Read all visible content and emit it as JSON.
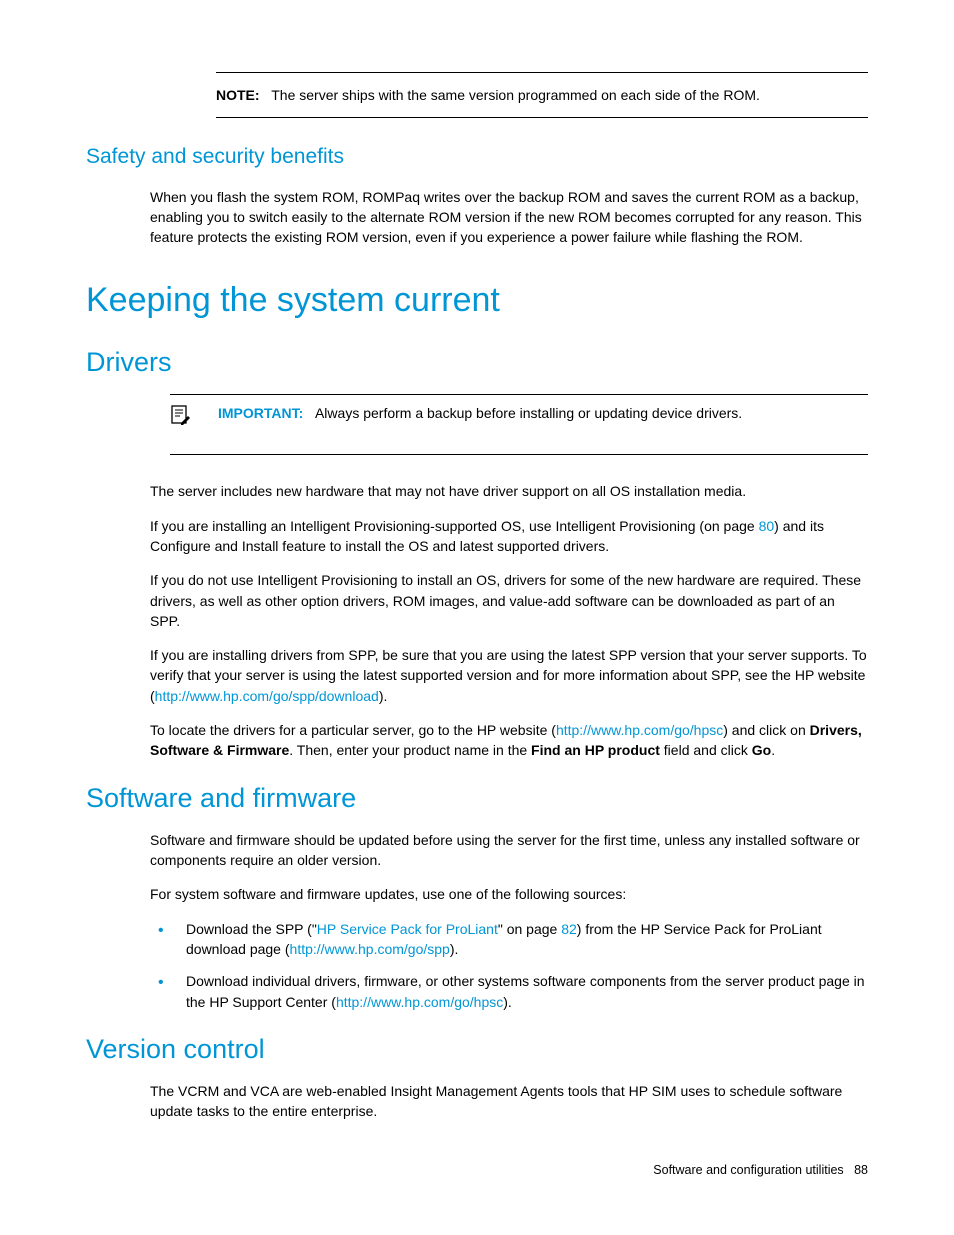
{
  "note": {
    "label": "NOTE:",
    "text": "The server ships with the same version programmed on each side of the ROM."
  },
  "safety": {
    "heading": "Safety and security benefits",
    "p1": "When you flash the system ROM, ROMPaq writes over the backup ROM and saves the current ROM as a backup, enabling you to switch easily to the alternate ROM version if the new ROM becomes corrupted for any reason. This feature protects the existing ROM version, even if you experience a power failure while flashing the ROM."
  },
  "keeping": {
    "heading": "Keeping the system current"
  },
  "drivers": {
    "heading": "Drivers",
    "important_label": "IMPORTANT:",
    "important_text": "Always perform a backup before installing or updating device drivers.",
    "p1": "The server includes new hardware that may not have driver support on all OS installation media.",
    "p2a": "If you are installing an Intelligent Provisioning-supported OS, use Intelligent Provisioning (on page ",
    "p2_link": "80",
    "p2b": ") and its Configure and Install feature to install the OS and latest supported drivers.",
    "p3": "If you do not use Intelligent Provisioning to install an OS, drivers for some of the new hardware are required. These drivers, as well as other option drivers, ROM images, and value-add software can be downloaded as part of an SPP.",
    "p4a": "If you are installing drivers from SPP, be sure that you are using the latest SPP version that your server supports. To verify that your server is using the latest supported version and for more information about SPP, see the HP website (",
    "p4_link": "http://www.hp.com/go/spp/download",
    "p4b": ").",
    "p5a": "To locate the drivers for a particular server, go to the HP website (",
    "p5_link": "http://www.hp.com/go/hpsc",
    "p5b": ") and click on ",
    "p5_bold1": "Drivers, Software & Firmware",
    "p5c": ". Then, enter your product name in the ",
    "p5_bold2": "Find an HP product",
    "p5d": " field and click ",
    "p5_bold3": "Go",
    "p5e": "."
  },
  "software": {
    "heading": "Software and firmware",
    "p1": "Software and firmware should be updated before using the server for the first time, unless any installed software or components require an older version.",
    "p2": "For system software and firmware updates, use one of the following sources:",
    "li1a": "Download the SPP (\"",
    "li1_link1": "HP Service Pack for ProLiant",
    "li1b": "\" on page ",
    "li1_link2": "82",
    "li1c": ") from the HP Service Pack for ProLiant download page (",
    "li1_link3": "http://www.hp.com/go/spp",
    "li1d": ").",
    "li2a": "Download individual drivers, firmware, or other systems software components from the server product page in the HP Support Center (",
    "li2_link": "http://www.hp.com/go/hpsc",
    "li2b": ")."
  },
  "version": {
    "heading": "Version control",
    "p1": "The VCRM and VCA are web-enabled Insight Management Agents tools that HP SIM uses to schedule software update tasks to the entire enterprise."
  },
  "footer": {
    "section": "Software and configuration utilities",
    "page": "88"
  }
}
